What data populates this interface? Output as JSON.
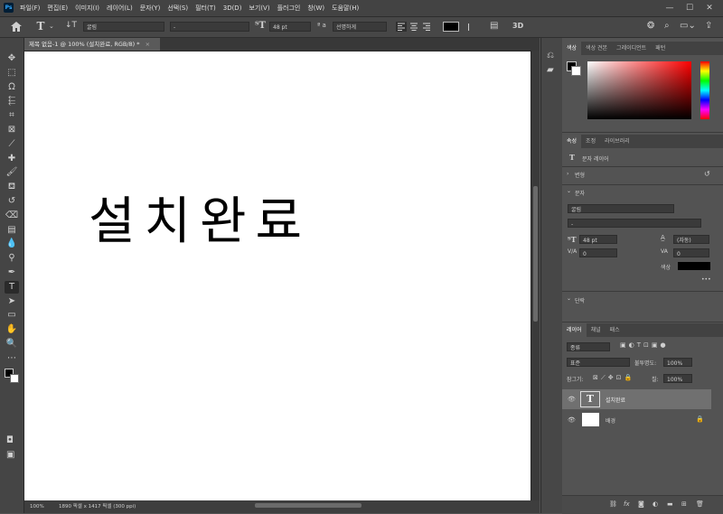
{
  "app": {
    "logo": "Ps"
  },
  "menu": {
    "items": [
      "파일(F)",
      "편집(E)",
      "이미지(I)",
      "레이어(L)",
      "문자(Y)",
      "선택(S)",
      "필터(T)",
      "3D(D)",
      "보기(V)",
      "플러그인",
      "창(W)",
      "도움말(H)"
    ]
  },
  "window": {
    "minimize": "—",
    "maximize": "☐",
    "close": "✕"
  },
  "options": {
    "home_icon": "home-icon",
    "font_family": "굴림",
    "font_style": "-",
    "font_size": "48 pt",
    "aa_label": "ª a",
    "antialias": "선명하게",
    "text_color": "#000000",
    "label_3d": "3D"
  },
  "document": {
    "tab_title": "제목 없음-1 @ 100% (설치완료, RGB/8) *",
    "tab_close": "×",
    "canvas_text": "설치완료",
    "zoom": "100%",
    "info": "1890 픽셀 x 1417 픽셀 (300 ppi)"
  },
  "toolbar": {
    "tools": [
      {
        "name": "move-tool",
        "glyph": "✥"
      },
      {
        "name": "marquee-tool",
        "glyph": "⬚"
      },
      {
        "name": "lasso-tool",
        "glyph": "ᘯ"
      },
      {
        "name": "object-select-tool",
        "glyph": "⬱"
      },
      {
        "name": "crop-tool",
        "glyph": "⌗"
      },
      {
        "name": "frame-tool",
        "glyph": "⊠"
      },
      {
        "name": "eyedropper-tool",
        "glyph": "⟋"
      },
      {
        "name": "healing-tool",
        "glyph": "✚"
      },
      {
        "name": "brush-tool",
        "glyph": "🖌"
      },
      {
        "name": "stamp-tool",
        "glyph": "⛾"
      },
      {
        "name": "history-brush-tool",
        "glyph": "↺"
      },
      {
        "name": "eraser-tool",
        "glyph": "⌫"
      },
      {
        "name": "gradient-tool",
        "glyph": "▤"
      },
      {
        "name": "blur-tool",
        "glyph": "💧"
      },
      {
        "name": "dodge-tool",
        "glyph": "⚲"
      },
      {
        "name": "pen-tool",
        "glyph": "✒"
      },
      {
        "name": "type-tool",
        "glyph": "T"
      },
      {
        "name": "path-select-tool",
        "glyph": "➤"
      },
      {
        "name": "rectangle-tool",
        "glyph": "▭"
      },
      {
        "name": "hand-tool",
        "glyph": "✋"
      },
      {
        "name": "zoom-tool",
        "glyph": "🔍"
      },
      {
        "name": "more-tools",
        "glyph": "⋯"
      }
    ],
    "fg_color": "#000000",
    "bg_color": "#ffffff"
  },
  "color_panel": {
    "tabs": [
      "색상",
      "색상 견본",
      "그레이디언트",
      "패턴"
    ],
    "hue": "#ff0000"
  },
  "props_panel": {
    "tabs": [
      "속성",
      "조정",
      "라이브러리"
    ],
    "layer_type": "문자 레이어",
    "transform_label": "변형",
    "type_label": "문자",
    "font_family": "굴림",
    "font_style": "-",
    "size": "48 pt",
    "leading": "(자동)",
    "tracking": "0",
    "kerning": "0",
    "color_label": "색상",
    "color": "#000000",
    "more": "•••",
    "paragraph_label": "단락"
  },
  "layers_panel": {
    "tabs": [
      "레이어",
      "채널",
      "패스"
    ],
    "filter_label": "종류",
    "blend_mode": "표준",
    "opacity_label": "불투명도:",
    "opacity": "100%",
    "lock_label": "잠그기:",
    "fill_label": "칠:",
    "fill": "100%",
    "layers": [
      {
        "name": "설치완료",
        "type": "text",
        "selected": true
      },
      {
        "name": "배경",
        "type": "background",
        "selected": false,
        "locked": true
      }
    ],
    "footer_icons": [
      "link-icon",
      "fx-icon",
      "mask-icon",
      "adjustment-icon",
      "group-icon",
      "new-layer-icon",
      "trash-icon"
    ]
  }
}
